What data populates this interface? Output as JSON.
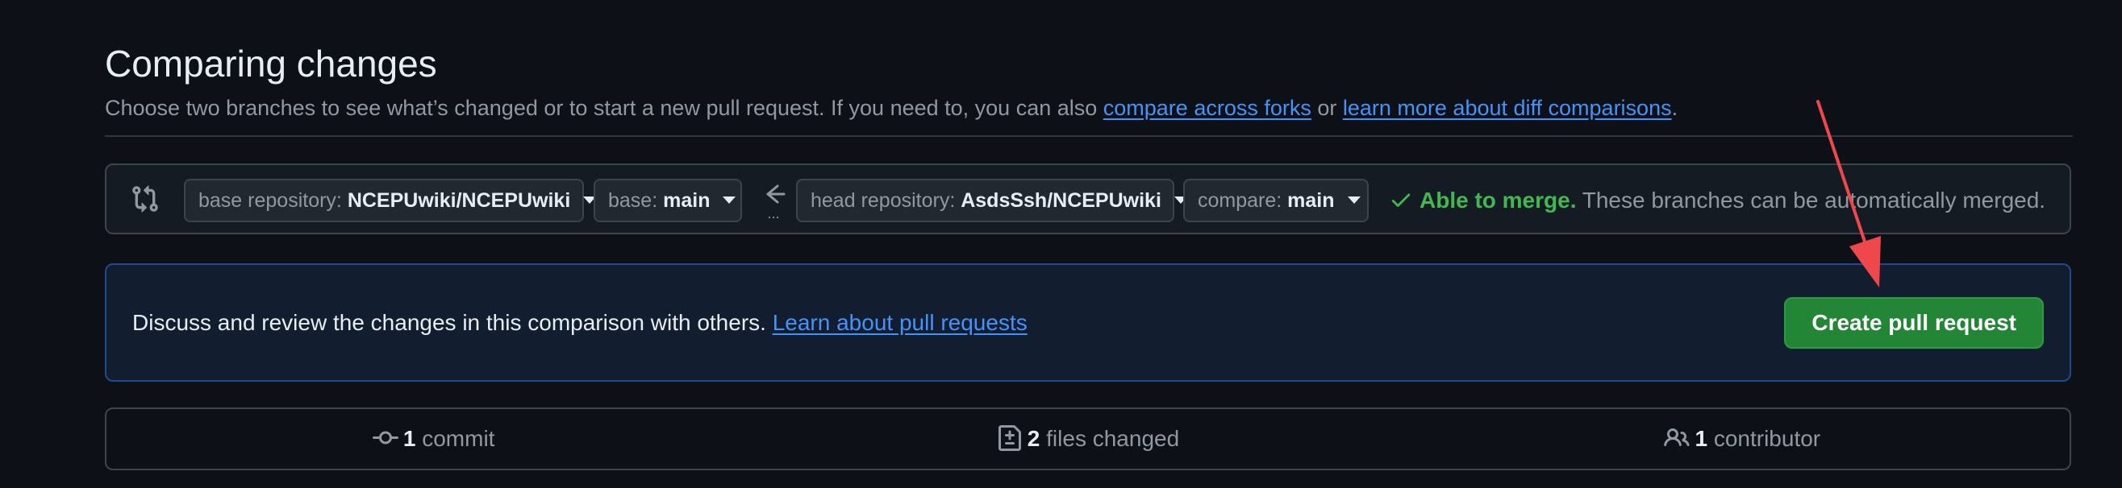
{
  "header": {
    "title": "Comparing changes",
    "subtitle_prefix": "Choose two branches to see what’s changed or to start a new pull request. If you need to, you can also ",
    "link_forks": "compare across forks",
    "subtitle_or": " or ",
    "link_diff": "learn more about diff comparisons",
    "subtitle_end": "."
  },
  "range": {
    "base_repo_label": "base repository: ",
    "base_repo_value": "NCEPUwiki/NCEPUwiki",
    "base_label": "base: ",
    "base_value": "main",
    "head_repo_label": "head repository: ",
    "head_repo_value": "AsdsSsh/NCEPUwiki",
    "compare_label": "compare: ",
    "compare_value": "main",
    "arrow_dots": "...",
    "merge_ok": "Able to merge.",
    "merge_msg": " These branches can be automatically merged."
  },
  "blankslate": {
    "text": "Discuss and review the changes in this comparison with others. ",
    "link": "Learn about pull requests",
    "button": "Create pull request"
  },
  "summary": {
    "commits_num": "1",
    "commits_label": " commit",
    "files_num": "2",
    "files_label": " files changed",
    "contributors_num": "1",
    "contributors_label": " contributor"
  },
  "colors": {
    "background": "#0d1117",
    "link": "#4493f8",
    "success": "#3fb950",
    "button": "#238636",
    "annotation": "#f0474c"
  },
  "icons": {
    "compare": "git-compare-icon",
    "arrow": "arrow-left-icon",
    "check": "check-icon",
    "commit": "git-commit-icon",
    "file_diff": "file-diff-icon",
    "people": "people-icon"
  }
}
